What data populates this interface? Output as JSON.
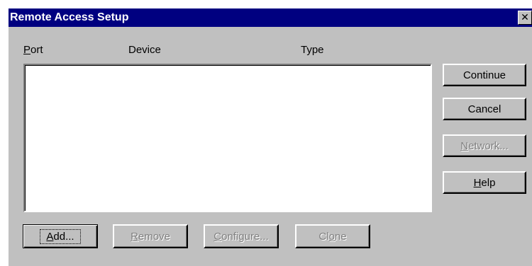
{
  "window": {
    "title": "Remote Access Setup",
    "close_glyph": "✕"
  },
  "columns": {
    "port": {
      "accel": "P",
      "rest": "ort"
    },
    "device": "Device",
    "type": "Type"
  },
  "side_buttons": {
    "continue": "Continue",
    "cancel": "Cancel",
    "network": {
      "accel": "N",
      "rest": "etwork..."
    },
    "help": {
      "accel": "H",
      "rest": "elp"
    }
  },
  "bottom_buttons": {
    "add": {
      "accel": "A",
      "rest": "dd..."
    },
    "remove": {
      "accel": "R",
      "rest": "emove"
    },
    "configure": {
      "accel": "C",
      "rest": "onfigure..."
    },
    "clone": {
      "pre": "Cl",
      "accel": "o",
      "rest": "ne"
    }
  },
  "port_list": []
}
